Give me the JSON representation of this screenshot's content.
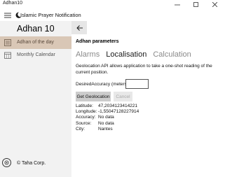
{
  "window": {
    "title": "Adhan10",
    "minimize_glyph": "—",
    "maximize_glyph": "☐",
    "close_glyph": "✕"
  },
  "appbar": {
    "title": "Islamic Prayer Notification",
    "menu_icon": "hamburger-icon",
    "logo_icon": "crescent-icon"
  },
  "sidebar": {
    "heading": "Adhan 10",
    "items": [
      {
        "label": "Adhan of the day",
        "icon": "list-icon",
        "active": true
      },
      {
        "label": "Monthly Calendar",
        "icon": "calendar-icon",
        "active": false
      }
    ],
    "footer_label": "© Taha Corp.",
    "footer_icon": "copyright-icon"
  },
  "content": {
    "back_icon": "back-arrow-icon",
    "params_title": "Adhan parameters",
    "tabs": [
      {
        "label": "Alarms",
        "active": false
      },
      {
        "label": "Localisation",
        "active": true
      },
      {
        "label": "Calculation",
        "active": false
      }
    ],
    "description": "Geolocation API allows application to take a one-shot reading of the current position.",
    "accuracy_label": "DesiredAccuracy (meters):",
    "accuracy_value": "",
    "get_button": "Get Geolocation",
    "cancel_button": "Cancel",
    "info": [
      {
        "key": "Latitude:",
        "value": "47,2034123414221"
      },
      {
        "key": "Longitude:",
        "value": "-1,55047128227914"
      },
      {
        "key": "Accuracy:",
        "value": "No data"
      },
      {
        "key": "Source:",
        "value": "No data"
      },
      {
        "key": "City:",
        "value": "Nantes"
      }
    ]
  },
  "colors": {
    "active_nav": "#d9c7b6",
    "sidebar_bg": "#f2f2f2",
    "button_bg": "#cccccc"
  }
}
